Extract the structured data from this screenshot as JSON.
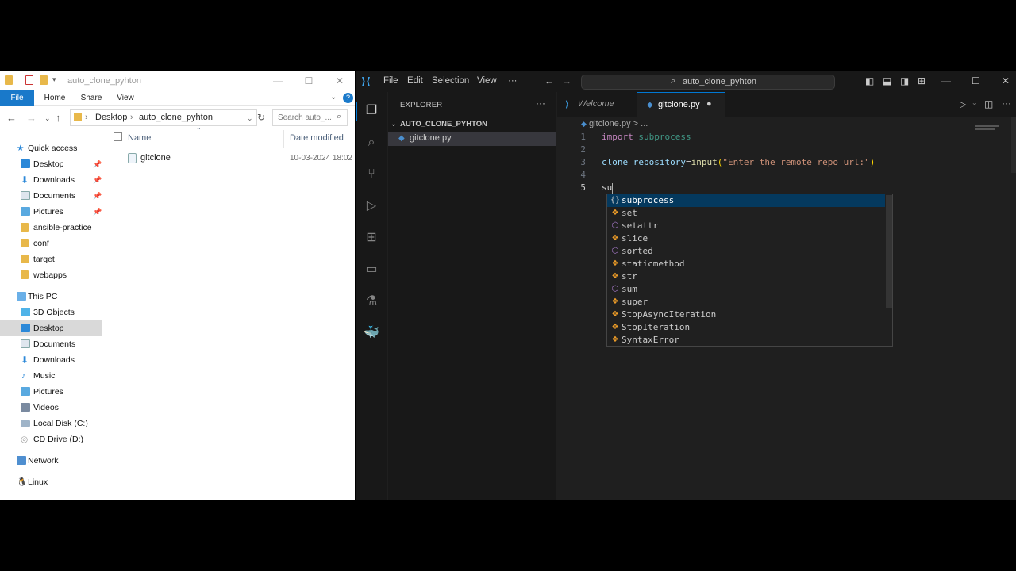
{
  "explorer": {
    "title": "auto_clone_pyhton",
    "ribbon_tabs": [
      "File",
      "Home",
      "Share",
      "View"
    ],
    "address": {
      "segment1": "Desktop",
      "segment2": "auto_clone_pyhton"
    },
    "search_placeholder": "Search auto_...",
    "nav": {
      "quick_access": "Quick access",
      "pinned": [
        "Desktop",
        "Downloads",
        "Documents",
        "Pictures"
      ],
      "folders": [
        "ansible-practice",
        "conf",
        "target",
        "webapps"
      ],
      "this_pc": "This PC",
      "pc_items": [
        "3D Objects",
        "Desktop",
        "Documents",
        "Downloads",
        "Music",
        "Pictures",
        "Videos",
        "Local Disk (C:)",
        "CD Drive (D:)"
      ],
      "network": "Network",
      "linux": "Linux"
    },
    "columns": {
      "name": "Name",
      "modified": "Date modified"
    },
    "files": [
      {
        "name": "gitclone",
        "modified": "10-03-2024 18:02"
      }
    ]
  },
  "vscode": {
    "menu": [
      "File",
      "Edit",
      "Selection",
      "View",
      "···"
    ],
    "command_center": "auto_clone_pyhton",
    "sidebar_title": "EXPLORER",
    "folder_name": "AUTO_CLONE_PYHTON",
    "file_name": "gitclone.py",
    "tabs": {
      "welcome": "Welcome",
      "active": "gitclone.py"
    },
    "breadcrumb": {
      "file": "gitclone.py",
      "rest": "...",
      "sep": ">"
    },
    "code": {
      "line_numbers": [
        "1",
        "2",
        "3",
        "4",
        "5"
      ],
      "l1_kw": "import",
      "l1_mod": "subprocess",
      "l3_var": "clone_repository",
      "l3_eq": "=",
      "l3_fn": "input",
      "l3_open": "(",
      "l3_str": "\"Enter the remote repo url:\"",
      "l3_close": ")",
      "l5": "su"
    },
    "suggestions": [
      {
        "icon": "{}",
        "label": "subprocess",
        "kind": "module"
      },
      {
        "icon": "class",
        "label": "set",
        "kind": "class"
      },
      {
        "icon": "func",
        "label": "setattr",
        "kind": "function"
      },
      {
        "icon": "class",
        "label": "slice",
        "kind": "class"
      },
      {
        "icon": "func",
        "label": "sorted",
        "kind": "function"
      },
      {
        "icon": "class",
        "label": "staticmethod",
        "kind": "class"
      },
      {
        "icon": "class",
        "label": "str",
        "kind": "class"
      },
      {
        "icon": "func",
        "label": "sum",
        "kind": "function"
      },
      {
        "icon": "class",
        "label": "super",
        "kind": "class"
      },
      {
        "icon": "class",
        "label": "StopAsyncIteration",
        "kind": "class"
      },
      {
        "icon": "class",
        "label": "StopIteration",
        "kind": "class"
      },
      {
        "icon": "class",
        "label": "SyntaxError",
        "kind": "class"
      }
    ]
  },
  "colors": {
    "keyword": "#c586c0",
    "module": "#4ec9b0",
    "variable": "#9cdcfe",
    "function": "#dcdcaa",
    "string": "#ce9178",
    "class_icon": "#ee9d28",
    "function_icon": "#b180d7",
    "accent": "#0078d4"
  }
}
